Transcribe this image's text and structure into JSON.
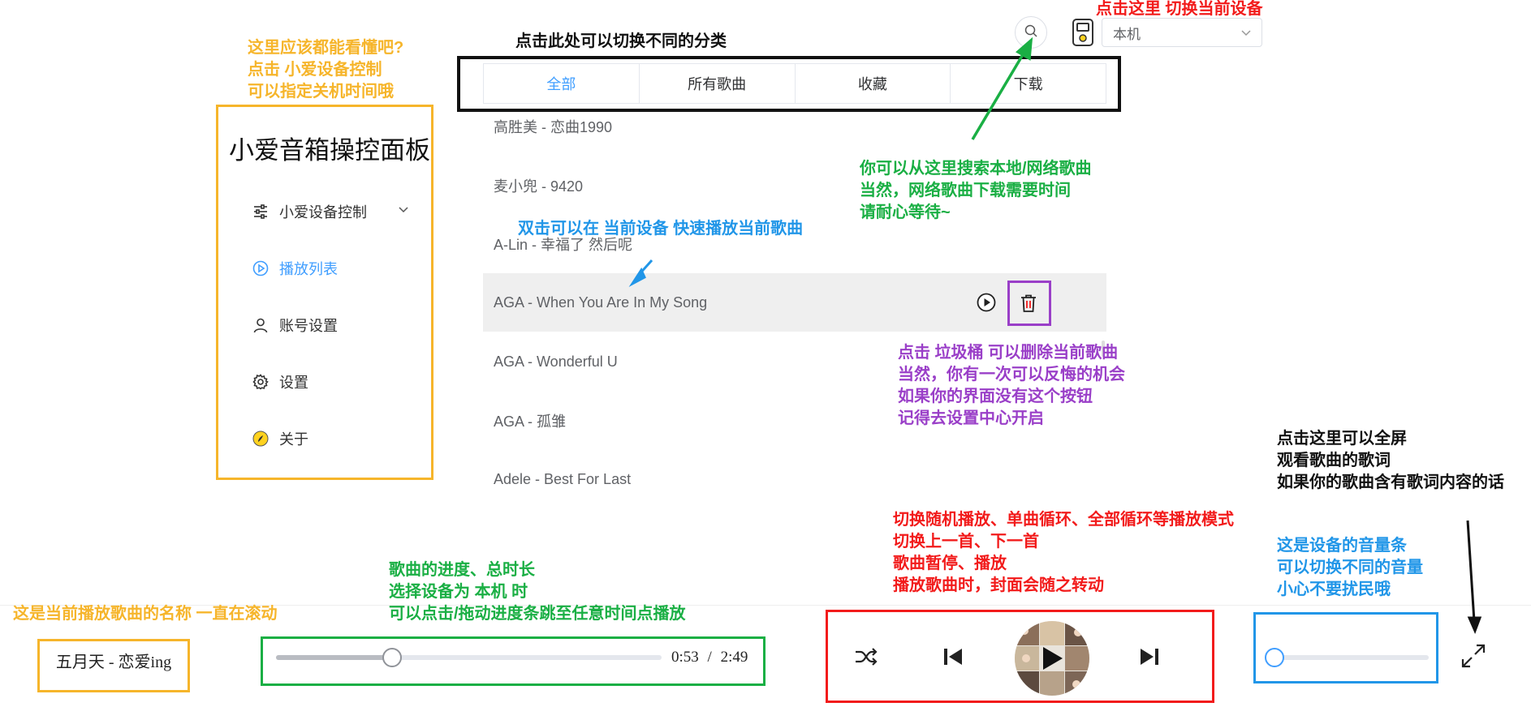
{
  "sidebar": {
    "title": "小爱音箱操控面板",
    "items": [
      {
        "label": "小爱设备控制",
        "icon": "sliders-icon"
      },
      {
        "label": "播放列表",
        "icon": "play-circle-icon"
      },
      {
        "label": "账号设置",
        "icon": "user-icon"
      },
      {
        "label": "设置",
        "icon": "gear-icon"
      },
      {
        "label": "关于",
        "icon": "about-icon"
      }
    ]
  },
  "tabs": [
    "全部",
    "所有歌曲",
    "收藏",
    "下载"
  ],
  "songs": [
    "高胜美 - 恋曲1990",
    "麦小兜 - 9420",
    "A-Lin - 幸福了 然后呢",
    "AGA - When You Are In My Song",
    "AGA - Wonderful U",
    "AGA - 孤雏",
    "Adele - Best For Last"
  ],
  "device_select": {
    "value": "本机"
  },
  "player": {
    "now_playing": "五月天 - 恋爱ing",
    "current_time": "0:53",
    "separator": "/",
    "total_time": "2:49",
    "progress_fraction": 0.3,
    "volume_fraction": 0.0
  },
  "annotations": {
    "sidebar_hint": "这里应该都能看懂吧?\n点击 小爱设备控制\n可以指定关机时间哦",
    "tabs_hint": "点击此处可以切换不同的分类",
    "device_hint": "点击这里 切换当前设备",
    "search_hint": "你可以从这里搜索本地/网络歌曲\n当然，网络歌曲下载需要时间\n请耐心等待~",
    "doubleclick_hint": "双击可以在 当前设备 快速播放当前歌曲",
    "delete_hint": "点击 垃圾桶 可以删除当前歌曲\n当然，你有一次可以反悔的机会\n如果你的界面没有这个按钮\n记得去设置中心开启",
    "fullscreen_hint": "点击这里可以全屏\n观看歌曲的歌词\n如果你的歌曲含有歌词内容的话",
    "volume_hint": "这是设备的音量条\n可以切换不同的音量\n小心不要扰民哦",
    "mode_hint": "切换随机播放、单曲循环、全部循环等播放模式\n切换上一首、下一首\n歌曲暂停、播放\n播放歌曲时，封面会随之转动",
    "progress_hint": "歌曲的进度、总时长\n选择设备为 本机 时\n可以点击/拖动进度条跳至任意时间点播放",
    "nowplaying_hint": "这是当前播放歌曲的名称 一直在滚动"
  },
  "colors": {
    "accent": "#409eff",
    "annotation_orange": "#f6b52b",
    "annotation_green": "#1aaf44",
    "annotation_blue": "#2196e8",
    "annotation_red": "#f21b1b",
    "annotation_purple": "#9a3fc8"
  }
}
